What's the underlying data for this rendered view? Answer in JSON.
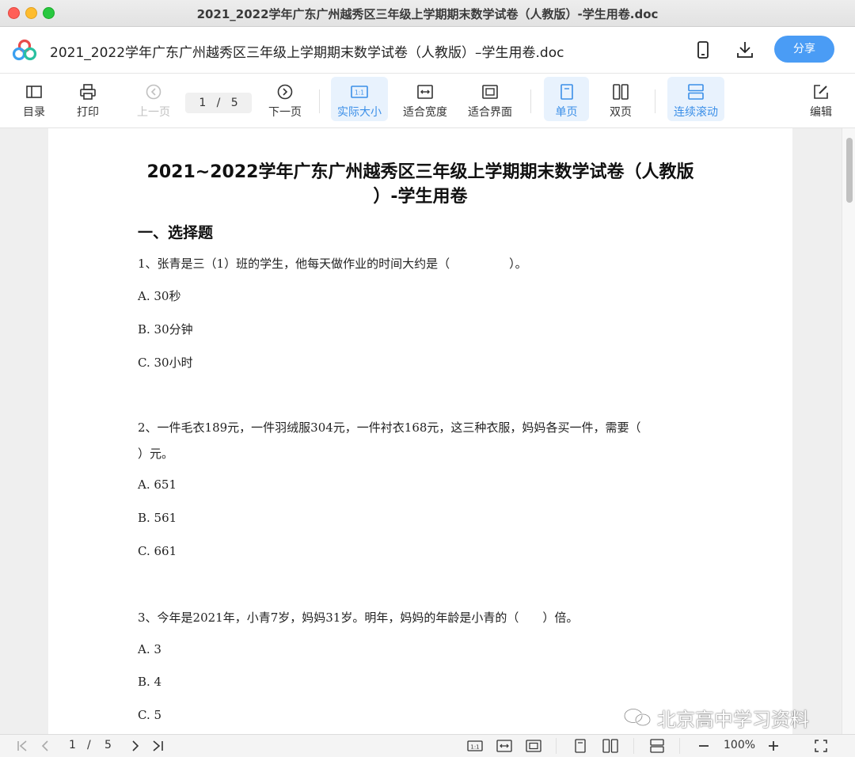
{
  "window": {
    "title": "2021_2022学年广东广州越秀区三年级上学期期末数学试卷（人教版）-学生用卷.doc"
  },
  "header": {
    "doc_title": "2021_2022学年广东广州越秀区三年级上学期期末数学试卷（人教版）–学生用卷.doc",
    "share_label": "分享"
  },
  "toolbar": {
    "toc": "目录",
    "print": "打印",
    "prev": "上一页",
    "page_current": "1",
    "page_sep": "/",
    "page_total": "5",
    "next": "下一页",
    "actual_size": "实际大小",
    "fit_width": "适合宽度",
    "fit_screen": "适合界面",
    "single_page": "单页",
    "double_page": "双页",
    "continuous": "连续滚动",
    "edit": "编辑"
  },
  "document": {
    "title_line1": "2021~2022学年广东广州越秀区三年级上学期期末数学试卷（人教版",
    "title_line2": "）-学生用卷",
    "section1": "一、选择题",
    "q1": "1、张青是三（1）班的学生，他每天做作业的时间大约是（　　　　　）。",
    "q1_a": "A.  30秒",
    "q1_b": "B.  30分钟",
    "q1_c": "C.  30小时",
    "q2_line1": "2、一件毛衣189元，一件羽绒服304元，一件衬衣168元，这三种衣服，妈妈各买一件，需要（",
    "q2_line2": "）元。",
    "q2_a": "A.  651",
    "q2_b": "B.  561",
    "q2_c": "C.  661",
    "q3": "3、今年是2021年，小青7岁，妈妈31岁。明年，妈妈的年龄是小青的（　　）倍。",
    "q3_a": "A.  3",
    "q3_b": "B.  4",
    "q3_c": "C.  5"
  },
  "watermark": "北京高中学习资料",
  "bottombar": {
    "page_current": "1",
    "page_sep": "/",
    "page_total": "5",
    "zoom": "100%"
  },
  "colors": {
    "accent": "#4a9cf5",
    "active_bg": "#e8f2fd",
    "active_text": "#3b8fe8"
  },
  "icons": [
    "app-logo-icon",
    "phone-icon",
    "download-icon",
    "toc-icon",
    "print-icon",
    "prev-page-icon",
    "next-page-icon",
    "actual-size-icon",
    "fit-width-icon",
    "fit-screen-icon",
    "single-page-icon",
    "double-page-icon",
    "continuous-scroll-icon",
    "edit-icon",
    "first-page-icon",
    "last-page-icon",
    "zoom-out-icon",
    "zoom-in-icon",
    "fullscreen-icon",
    "wechat-icon"
  ]
}
